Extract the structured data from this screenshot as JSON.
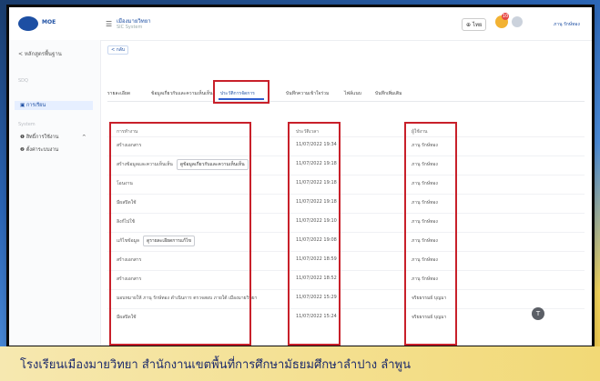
{
  "header": {
    "logo_text": "MOE",
    "app_title": "เมืองมายวิทยา",
    "app_subtitle": "SIC System",
    "lang_label": "ไทย",
    "notification_count": "10",
    "user_name": "ภานุ รักษ์ทอง"
  },
  "sidebar": {
    "back_label": "< หลักสูตรพื้นฐาน",
    "section1": "SDQ",
    "active_item": "การเรียน",
    "section2": "System",
    "items": [
      "สิทธิ์การใช้งาน",
      "ตั้งค่าระบบงาน"
    ]
  },
  "main": {
    "back_button": "< กลับ",
    "tabs": [
      "รายละเอียด",
      "ข้อมูลเกี่ยวกับและความเห็นเห็น",
      "ประวัติการจัดการ",
      "บันทึกความเข้าใจร่วม",
      "ไฟล์แนบ",
      "บันทึกเพิ่มเติม"
    ],
    "active_tab_index": 2,
    "columns": [
      "การทำงาน",
      "ประวัติเวลา",
      "ผู้ใช้งาน"
    ],
    "rows": [
      {
        "action": "สร้างเอกสาร",
        "button": "",
        "time": "11/07/2022 19:34",
        "user": "ภานุ รักษ์ทอง"
      },
      {
        "action": "สร้างข้อมูลและความเห็นเห็น",
        "button": "ดูข้อมูลเกี่ยวกับและความเห็นเห็น",
        "time": "11/07/2022 19:18",
        "user": "ภานุ รักษ์ทอง"
      },
      {
        "action": "โอนงาน",
        "button": "",
        "time": "11/07/2022 19:18",
        "user": "ภานุ รักษ์ทอง"
      },
      {
        "action": "มีผลปิดใช้",
        "button": "",
        "time": "11/07/2022 19:18",
        "user": "ภานุ รักษ์ทอง"
      },
      {
        "action": "ลิงก์ไปใช้",
        "button": "",
        "time": "11/07/2022 19:10",
        "user": "ภานุ รักษ์ทอง"
      },
      {
        "action": "แก้ไขข้อมูล",
        "button": "ดูรายละเอียดการแก้ไข",
        "time": "11/07/2022 19:08",
        "user": "ภานุ รักษ์ทอง"
      },
      {
        "action": "สร้างเอกสาร",
        "button": "",
        "time": "11/07/2022 18:59",
        "user": "ภานุ รักษ์ทอง"
      },
      {
        "action": "สร้างเอกสาร",
        "button": "",
        "time": "11/07/2022 18:52",
        "user": "ภานุ รักษ์ทอง"
      },
      {
        "action": "มอบหมายให้ ภานุ รักษ์ทอง ดำเนินการ ตรวจสอบ ภายใต้ เมืองมายวิทยา",
        "button": "",
        "time": "11/07/2022 15:29",
        "user": "จริยธรรมย์ บุญมา"
      },
      {
        "action": "มีผลปิดใช้",
        "button": "",
        "time": "11/07/2022 15:24",
        "user": "จริยธรรมย์ บุญมา"
      }
    ],
    "fab_label": "T"
  },
  "caption": "โรงเรียนเมืองมายวิทยา  สำนักงานเขตพื้นที่การศึกษามัธยมศึกษาลำปาง  ลำพูน",
  "colors": {
    "accent": "#1d4fa3",
    "highlight": "#c8202a"
  }
}
